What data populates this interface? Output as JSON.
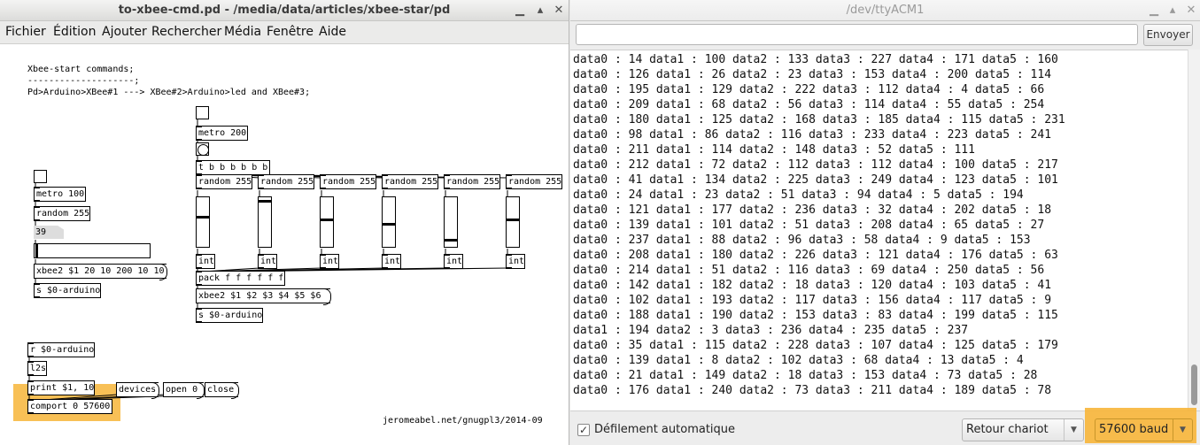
{
  "pd_window": {
    "title": "to-xbee-cmd.pd  - /media/data/articles/xbee-star/pd",
    "menu": [
      "Fichier",
      "Édition",
      "Ajouter",
      "Rechercher",
      "Média",
      "Fenêtre",
      "Aide"
    ],
    "comments": [
      "Xbee-start commands;",
      "--------------------;",
      "Pd>Arduino>XBee#1 ---> XBee#2>Arduino>led and XBee#3;"
    ],
    "objects": {
      "metro_200": "metro 200",
      "trigger": "t b b b b b b",
      "random": [
        "random 255",
        "random 255",
        "random 255",
        "random 255",
        "random 255",
        "random 255"
      ],
      "ints": [
        "int",
        "int",
        "int",
        "int",
        "int",
        "int"
      ],
      "pack": "pack f f f f f f",
      "send_arduino_2": "s $0-arduino",
      "metro_100": "metro 100",
      "random_left": "random 255",
      "number_value": "39",
      "send_arduino_1": "s $0-arduino",
      "receive_arduino": "r $0-arduino",
      "l2s": "l2s",
      "comport": "comport 0 57600"
    },
    "messages": {
      "xbee2_left": "xbee2 $1 20 10 200 10 10",
      "xbee2_right": "xbee2 $1 $2 $3 $4 $5 $6",
      "print": "print $1, 10",
      "devices": "devices",
      "open": "open 0",
      "close": "close"
    },
    "slider_values": [
      0.6,
      0.95,
      0.55,
      0.45,
      0.12,
      0.55
    ],
    "credit": "jeromeabel.net/gnugpl3/2014-09"
  },
  "monitor_window": {
    "title": "/dev/ttyACM1",
    "send_input_value": "",
    "send_button": "Envoyer",
    "autoscroll_label": "Défilement automatique",
    "autoscroll_checked": "✓",
    "line_ending": "Retour chariot",
    "baud": "57600 baud",
    "lines": [
      "data0 : 14 data1 : 100 data2 : 133 data3 : 227 data4 : 171 data5 : 160",
      "data0 : 126 data1 : 26 data2 : 23 data3 : 153 data4 : 200 data5 : 114",
      "data0 : 195 data1 : 129 data2 : 222 data3 : 112 data4 : 4 data5 : 66",
      "data0 : 209 data1 : 68 data2 : 56 data3 : 114 data4 : 55 data5 : 254",
      "data0 : 180 data1 : 125 data2 : 168 data3 : 185 data4 : 115 data5 : 231",
      "data0 : 98 data1 : 86 data2 : 116 data3 : 233 data4 : 223 data5 : 241",
      "data0 : 211 data1 : 114 data2 : 148 data3 : 52 data5 : 111",
      "data0 : 212 data1 : 72 data2 : 112 data3 : 112 data4 : 100 data5 : 217",
      "data0 : 41 data1 : 134 data2 : 225 data3 : 249 data4 : 123 data5 : 101",
      "data0 : 24 data1 : 23 data2 : 51 data3 : 94 data4 : 5 data5 : 194",
      "data0 : 121 data1 : 177 data2 : 236 data3 : 32 data4 : 202 data5 : 18",
      "data0 : 139 data1 : 101 data2 : 51 data3 : 208 data4 : 65 data5 : 27",
      "data0 : 237 data1 : 88 data2 : 96 data3 : 58 data4 : 9 data5 : 153",
      "data0 : 208 data1 : 180 data2 : 226 data3 : 121 data4 : 176 data5 : 63",
      "data0 : 214 data1 : 51 data2 : 116 data3 : 69 data4 : 250 data5 : 56",
      "data0 : 142 data1 : 182 data2 : 18 data3 : 120 data4 : 103 data5 : 41",
      "data0 : 102 data1 : 193 data2 : 117 data3 : 156 data4 : 117 data5 : 9",
      "data0 : 188 data1 : 190 data2 : 153 data3 : 83 data4 : 199 data5 : 115",
      "data1 : 194 data2 : 3 data3 : 236 data4 : 235 data5 : 237",
      "data0 : 35 data1 : 115 data2 : 228 data3 : 107 data4 : 125 data5 : 179",
      "data0 : 139 data1 : 8 data2 : 102 data3 : 68 data4 : 13 data5 : 4",
      "data0 : 21 data1 : 149 data2 : 18 data3 : 153 data4 : 73 data5 : 28",
      "data0 : 176 data1 : 240 data2 : 73 data3 : 211 data4 : 189 data5 : 78"
    ]
  },
  "colors": {
    "highlight": "#f7b538",
    "pd_background": "#ffffff",
    "monitor_background": "#ededed"
  }
}
